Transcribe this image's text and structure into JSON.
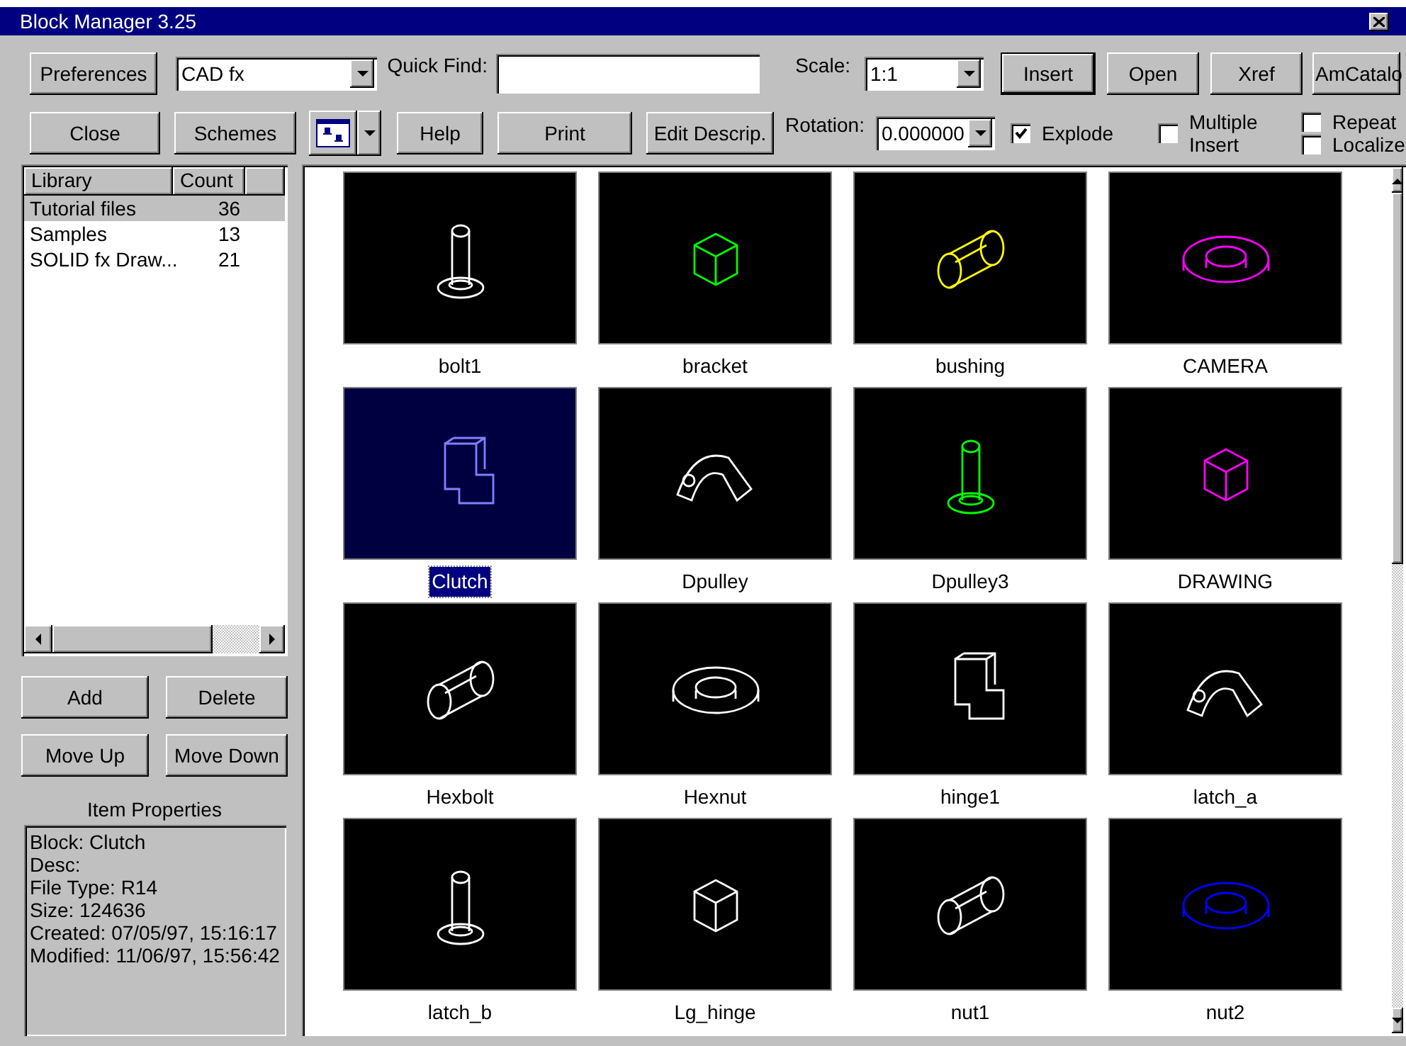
{
  "window": {
    "title": "Block Manager 3.25"
  },
  "toolbar_rows": [
    [
      {
        "kind": "button",
        "label": "Preferences",
        "default": false
      },
      {
        "kind": "combo",
        "value": "CAD fx"
      },
      {
        "kind": "label",
        "text": "Quick Find:"
      },
      {
        "kind": "field"
      },
      {
        "kind": "label",
        "text": "Scale:"
      },
      {
        "kind": "combo",
        "value": "1:1"
      },
      {
        "kind": "button",
        "label": "Insert",
        "default": true
      },
      {
        "kind": "button",
        "label": "Open",
        "default": false
      },
      {
        "kind": "button",
        "label": "Xref",
        "default": false
      },
      {
        "kind": "button",
        "label": "AmCatalo",
        "default": false
      }
    ],
    [
      {
        "kind": "button",
        "label": "Close",
        "default": false
      },
      {
        "kind": "button",
        "label": "Schemes",
        "default": false
      },
      {
        "kind": "viewmenu"
      },
      {
        "kind": "button",
        "label": "Help",
        "default": false
      },
      {
        "kind": "button",
        "label": "Print",
        "default": false
      },
      {
        "kind": "button",
        "label": "Edit Descrip.",
        "default": false
      },
      {
        "kind": "label",
        "text": "Rotation:"
      },
      {
        "kind": "combo",
        "value": "0.000000"
      },
      {
        "kind": "checkbox",
        "label": "Explode",
        "checked": true
      },
      {
        "kind": "checkbox",
        "label": "Multiple Insert",
        "checked": false
      },
      {
        "kind": "checkstack",
        "items": [
          {
            "label": "Repeat",
            "checked": false
          },
          {
            "label": "Localize",
            "checked": false
          }
        ]
      }
    ]
  ],
  "library": {
    "columns": [
      "Library",
      "Count"
    ],
    "rows": [
      {
        "name": "Tutorial files",
        "count": "36",
        "selected": true
      },
      {
        "name": "Samples",
        "count": "13",
        "selected": false
      },
      {
        "name": "SOLID fx Draw...",
        "count": "21",
        "selected": false
      }
    ]
  },
  "library_buttons": [
    "Add",
    "Delete",
    "Move Up",
    "Move Down"
  ],
  "item_properties": {
    "title": "Item Properties",
    "lines": [
      "Block: Clutch",
      "Desc:",
      "File Type: R14",
      "Size: 124636",
      "Created: 07/05/97, 15:16:17",
      "Modified: 11/06/97, 15:56:42"
    ]
  },
  "blocks": [
    {
      "name": "bolt1",
      "color": "#ffffff",
      "selected": false
    },
    {
      "name": "bracket",
      "color": "#00ff00",
      "selected": false
    },
    {
      "name": "bushing",
      "color": "#ffff00",
      "selected": false
    },
    {
      "name": "CAMERA",
      "color": "#ff00ff",
      "selected": false
    },
    {
      "name": "Clutch",
      "color": "#8080ff",
      "selected": true
    },
    {
      "name": "Dpulley",
      "color": "#ffffff",
      "selected": false
    },
    {
      "name": "Dpulley3",
      "color": "#00ff00",
      "selected": false
    },
    {
      "name": "DRAWING",
      "color": "#ff00ff",
      "selected": false
    },
    {
      "name": "Hexbolt",
      "color": "#ffffff",
      "selected": false
    },
    {
      "name": "Hexnut",
      "color": "#ffffff",
      "selected": false
    },
    {
      "name": "hinge1",
      "color": "#ffffff",
      "selected": false
    },
    {
      "name": "latch_a",
      "color": "#ffffff",
      "selected": false
    },
    {
      "name": "latch_b",
      "color": "#ffffff",
      "selected": false
    },
    {
      "name": "Lg_hinge",
      "color": "#ffffff",
      "selected": false
    },
    {
      "name": "nut1",
      "color": "#ffffff",
      "selected": false
    },
    {
      "name": "nut2",
      "color": "#0000ff",
      "selected": false
    }
  ]
}
